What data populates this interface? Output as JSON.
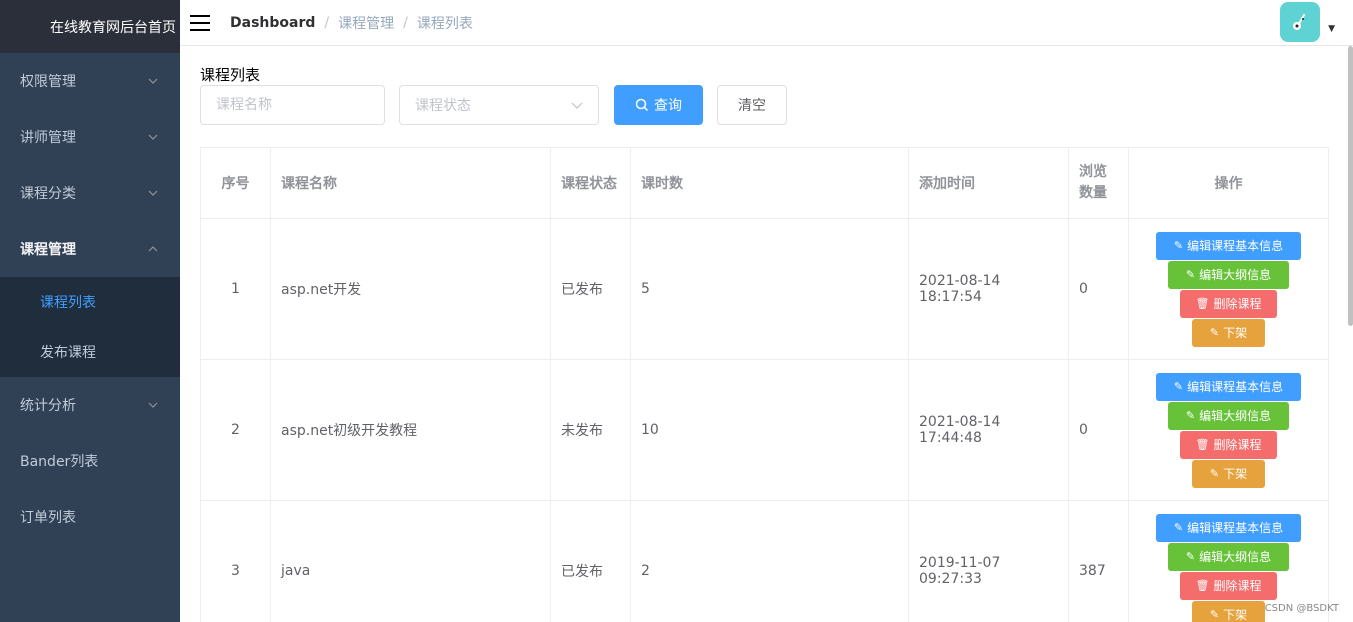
{
  "sidebar": {
    "logo": "在线教育网后台首页",
    "menus": [
      {
        "label": "权限管理"
      },
      {
        "label": "讲师管理"
      },
      {
        "label": "课程分类"
      },
      {
        "label": "课程管理"
      }
    ],
    "submenu": [
      {
        "label": "课程列表"
      },
      {
        "label": "发布课程"
      }
    ],
    "menus_after": [
      {
        "label": "统计分析"
      },
      {
        "label": "Bander列表"
      },
      {
        "label": "订单列表"
      }
    ]
  },
  "navbar": {
    "breadcrumb": [
      "Dashboard",
      "课程管理",
      "课程列表"
    ]
  },
  "main": {
    "title": "课程列表",
    "filters": {
      "name_placeholder": "课程名称",
      "status_placeholder": "课程状态",
      "query_label": "查询",
      "clear_label": "清空"
    },
    "table": {
      "headers": {
        "idx": "序号",
        "name": "课程名称",
        "status": "课程状态",
        "hours": "课时数",
        "time": "添加时间",
        "views": "浏览数量",
        "ops": "操作"
      },
      "rows": [
        {
          "idx": "1",
          "name": "asp.net开发",
          "status": "已发布",
          "hours": "5",
          "time": "2021-08-14 18:17:54",
          "views": "0"
        },
        {
          "idx": "2",
          "name": "asp.net初级开发教程",
          "status": "未发布",
          "hours": "10",
          "time": "2021-08-14 17:44:48",
          "views": "0"
        },
        {
          "idx": "3",
          "name": "java",
          "status": "已发布",
          "hours": "2",
          "time": "2019-11-07 09:27:33",
          "views": "387"
        }
      ],
      "ops": {
        "edit_basic": "编辑课程基本信息",
        "edit_outline": "编辑大纲信息",
        "delete": "删除课程",
        "offline": "下架"
      }
    }
  },
  "watermark": "CSDN @BSDKT",
  "colors": {
    "sidebar_bg": "#304156",
    "primary": "#409eff",
    "success": "#67c23a",
    "danger": "#f56c6c",
    "warning": "#e6a23c"
  }
}
